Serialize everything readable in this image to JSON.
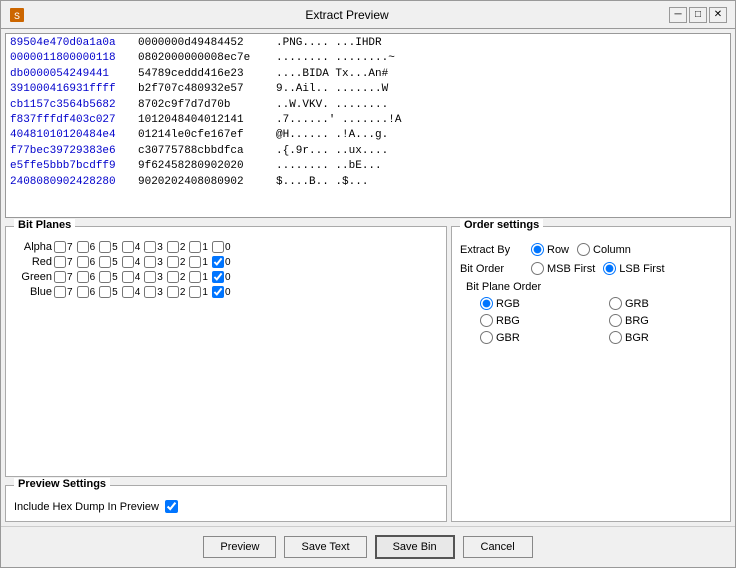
{
  "window": {
    "title": "Extract Preview",
    "min_label": "─",
    "max_label": "□",
    "close_label": "✕"
  },
  "hex_preview": {
    "rows": [
      {
        "addr": "89504e470d0a1a0a",
        "bytes": "0000000d49484452",
        "ascii": ".PNG.... ...IHDR"
      },
      {
        "addr": "0000011800000118",
        "bytes": "0802000000008ec7e",
        "ascii": "........ ........~"
      },
      {
        "addr": "db0000054249441",
        "bytes": "54789ceddd416e23",
        "ascii": "....BIDA Tx...An#"
      },
      {
        "addr": "391000416931ffff",
        "bytes": "b2f707c480932e57",
        "ascii": "9..Ail.. .......W"
      },
      {
        "addr": "cb1157c3564b5682",
        "bytes": "8702c9f7d7d70b",
        "ascii": "..W.VKV. ........"
      },
      {
        "addr": "f837fffdf403c027",
        "bytes": "1012048404012141",
        "ascii": ".7......' .......!A"
      },
      {
        "addr": "40481010120484e4",
        "bytes": "01214le0cfe167ef",
        "ascii": "@H...... .!A...g."
      },
      {
        "addr": "f77bec39729383e6",
        "bytes": "c30775788cbbdfca",
        "ascii": ".{.9r... ..ux...."
      },
      {
        "addr": "e5ffe5bbb7bcdff9",
        "bytes": "9f62458280902020",
        "ascii": "........ ..bE..."
      },
      {
        "addr": "2408080902428280",
        "bytes": "9020202408080902",
        "ascii": "$....B.. .$..."
      }
    ]
  },
  "bit_planes": {
    "title": "Bit Planes",
    "channels": [
      {
        "label": "Alpha",
        "bits": [
          {
            "num": "7",
            "checked": false
          },
          {
            "num": "6",
            "checked": false
          },
          {
            "num": "5",
            "checked": false
          },
          {
            "num": "4",
            "checked": false
          },
          {
            "num": "3",
            "checked": false
          },
          {
            "num": "2",
            "checked": false
          },
          {
            "num": "1",
            "checked": false
          },
          {
            "num": "0",
            "checked": false
          }
        ]
      },
      {
        "label": "Red",
        "bits": [
          {
            "num": "7",
            "checked": false
          },
          {
            "num": "6",
            "checked": false
          },
          {
            "num": "5",
            "checked": false
          },
          {
            "num": "4",
            "checked": false
          },
          {
            "num": "3",
            "checked": false
          },
          {
            "num": "2",
            "checked": false
          },
          {
            "num": "1",
            "checked": false
          },
          {
            "num": "0",
            "checked": true
          }
        ]
      },
      {
        "label": "Green",
        "bits": [
          {
            "num": "7",
            "checked": false
          },
          {
            "num": "6",
            "checked": false
          },
          {
            "num": "5",
            "checked": false
          },
          {
            "num": "4",
            "checked": false
          },
          {
            "num": "3",
            "checked": false
          },
          {
            "num": "2",
            "checked": false
          },
          {
            "num": "1",
            "checked": false
          },
          {
            "num": "0",
            "checked": true
          }
        ]
      },
      {
        "label": "Blue",
        "bits": [
          {
            "num": "7",
            "checked": false
          },
          {
            "num": "6",
            "checked": false
          },
          {
            "num": "5",
            "checked": false
          },
          {
            "num": "4",
            "checked": false
          },
          {
            "num": "3",
            "checked": false
          },
          {
            "num": "2",
            "checked": false
          },
          {
            "num": "1",
            "checked": false
          },
          {
            "num": "0",
            "checked": true
          }
        ]
      }
    ]
  },
  "preview_settings": {
    "title": "Preview Settings",
    "include_hex_label": "Include Hex Dump In Preview"
  },
  "order_settings": {
    "title": "Order settings",
    "extract_by_label": "Extract By",
    "row_label": "Row",
    "column_label": "Column",
    "bit_order_label": "Bit Order",
    "msb_first_label": "MSB First",
    "lsb_first_label": "LSB First",
    "bit_plane_order_label": "Bit Plane Order",
    "options": [
      "RGB",
      "GRB",
      "RBG",
      "BRG",
      "GBR",
      "BGR"
    ]
  },
  "footer": {
    "preview_label": "Preview",
    "save_text_label": "Save Text",
    "save_bin_label": "Save Bin",
    "cancel_label": "Cancel"
  }
}
